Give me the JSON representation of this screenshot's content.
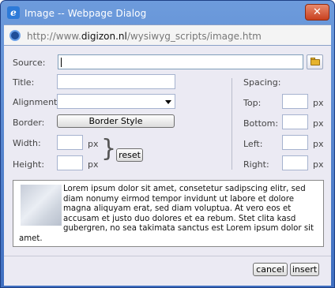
{
  "window": {
    "title": "Image -- Webpage Dialog",
    "close_label": "✕"
  },
  "address": {
    "prefix": "http://www.",
    "domain": "digizon.nl",
    "path": "/wysiwyg_scripts/image.htm"
  },
  "form": {
    "source_label": "Source:",
    "source_value": "",
    "title_label": "Title:",
    "title_value": "",
    "alignment_label": "Alignment:",
    "alignment_value": "",
    "border_label": "Border:",
    "border_button": "Border Style",
    "width_label": "Width:",
    "width_value": "",
    "width_unit": "px",
    "height_label": "Height:",
    "height_value": "",
    "height_unit": "px",
    "reset_button": "reset"
  },
  "spacing": {
    "heading": "Spacing:",
    "top_label": "Top:",
    "top_unit": "px",
    "bottom_label": "Bottom:",
    "bottom_unit": "px",
    "left_label": "Left:",
    "left_unit": "px",
    "right_label": "Right:",
    "right_unit": "px"
  },
  "preview": {
    "text": "Lorem ipsum dolor sit amet, consetetur sadipscing elitr, sed diam nonumy eirmod tempor invidunt ut labore et dolore magna aliquyam erat, sed diam voluptua. At vero eos et accusam et justo duo dolores et ea rebum. Stet clita kasd gubergren, no sea takimata sanctus est Lorem ipsum dolor sit amet."
  },
  "actions": {
    "cancel": "cancel",
    "insert": "insert"
  },
  "icons": {
    "window_icon": "ie-page-icon",
    "address_icon": "globe-icon",
    "browse_icon": "folder-icon"
  }
}
